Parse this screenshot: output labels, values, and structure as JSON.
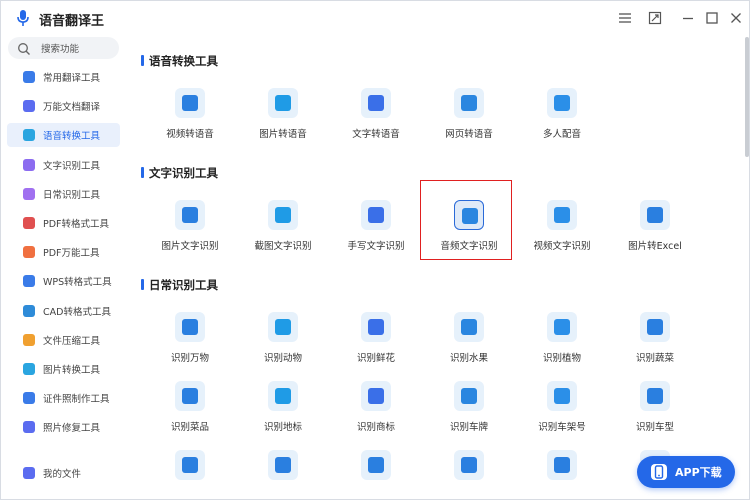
{
  "app": {
    "title": "语音翻译王"
  },
  "search": {
    "placeholder": "搜索功能"
  },
  "sidebar": {
    "items": [
      {
        "label": "常用翻译工具",
        "icon": "translate-icon",
        "color": "#3a7be8"
      },
      {
        "label": "万能文档翻译",
        "icon": "document-icon",
        "color": "#5b6cf0"
      },
      {
        "label": "语音转换工具",
        "icon": "voice-convert-icon",
        "color": "#2aa5e0",
        "active": true
      },
      {
        "label": "文字识别工具",
        "icon": "text-recognition-icon",
        "color": "#8c6cf0"
      },
      {
        "label": "日常识别工具",
        "icon": "daily-recognition-icon",
        "color": "#a070f0"
      },
      {
        "label": "PDF转格式工具",
        "icon": "pdf-convert-icon",
        "color": "#e05050"
      },
      {
        "label": "PDF万能工具",
        "icon": "pdf-tools-icon",
        "color": "#f07040"
      },
      {
        "label": "WPS转格式工具",
        "icon": "wps-convert-icon",
        "color": "#3a7be8"
      },
      {
        "label": "CAD转格式工具",
        "icon": "cad-convert-icon",
        "color": "#2e8bd8"
      },
      {
        "label": "文件压缩工具",
        "icon": "compress-icon",
        "color": "#f0a030"
      },
      {
        "label": "图片转换工具",
        "icon": "image-convert-icon",
        "color": "#2aa5e0"
      },
      {
        "label": "证件照制作工具",
        "icon": "id-photo-icon",
        "color": "#3a7be8"
      },
      {
        "label": "照片修复工具",
        "icon": "photo-repair-icon",
        "color": "#5b6cf0"
      }
    ],
    "my_files": {
      "label": "我的文件",
      "icon": "my-files-icon",
      "color": "#5b6cf0"
    }
  },
  "sections": [
    {
      "title": "语音转换工具",
      "tools": [
        {
          "label": "视频转语音",
          "icon": "video-to-voice-icon"
        },
        {
          "label": "图片转语音",
          "icon": "image-to-voice-icon"
        },
        {
          "label": "文字转语音",
          "icon": "text-to-voice-icon"
        },
        {
          "label": "网页转语音",
          "icon": "web-to-voice-icon"
        },
        {
          "label": "多人配音",
          "icon": "multi-dubbing-icon"
        }
      ]
    },
    {
      "title": "文字识别工具",
      "tools": [
        {
          "label": "图片文字识别",
          "icon": "image-ocr-icon"
        },
        {
          "label": "截图文字识别",
          "icon": "screenshot-ocr-icon"
        },
        {
          "label": "手写文字识别",
          "icon": "handwriting-ocr-icon"
        },
        {
          "label": "音频文字识别",
          "icon": "audio-to-text-icon",
          "selected": true
        },
        {
          "label": "视频文字识别",
          "icon": "video-ocr-icon"
        },
        {
          "label": "图片转Excel",
          "icon": "image-to-excel-icon"
        }
      ]
    },
    {
      "title": "日常识别工具",
      "tools": [
        {
          "label": "识别万物",
          "icon": "recognize-all-icon"
        },
        {
          "label": "识别动物",
          "icon": "recognize-animal-icon"
        },
        {
          "label": "识别鲜花",
          "icon": "recognize-flower-icon"
        },
        {
          "label": "识别水果",
          "icon": "recognize-fruit-icon"
        },
        {
          "label": "识别植物",
          "icon": "recognize-plant-icon"
        },
        {
          "label": "识别蔬菜",
          "icon": "recognize-vegetable-icon"
        },
        {
          "label": "识别菜品",
          "icon": "recognize-dish-icon"
        },
        {
          "label": "识别地标",
          "icon": "recognize-landmark-icon"
        },
        {
          "label": "识别商标",
          "icon": "recognize-trademark-icon"
        },
        {
          "label": "识别车牌",
          "icon": "recognize-plate-icon"
        },
        {
          "label": "识别车架号",
          "icon": "recognize-vin-icon"
        },
        {
          "label": "识别车型",
          "icon": "recognize-car-model-icon"
        }
      ]
    }
  ],
  "app_download": {
    "label": "APP下载",
    "icon": "phone-icon"
  },
  "colors": {
    "accent": "#2468e8",
    "tile_bg": "#e6f1fb",
    "highlight_border": "#e02020"
  }
}
